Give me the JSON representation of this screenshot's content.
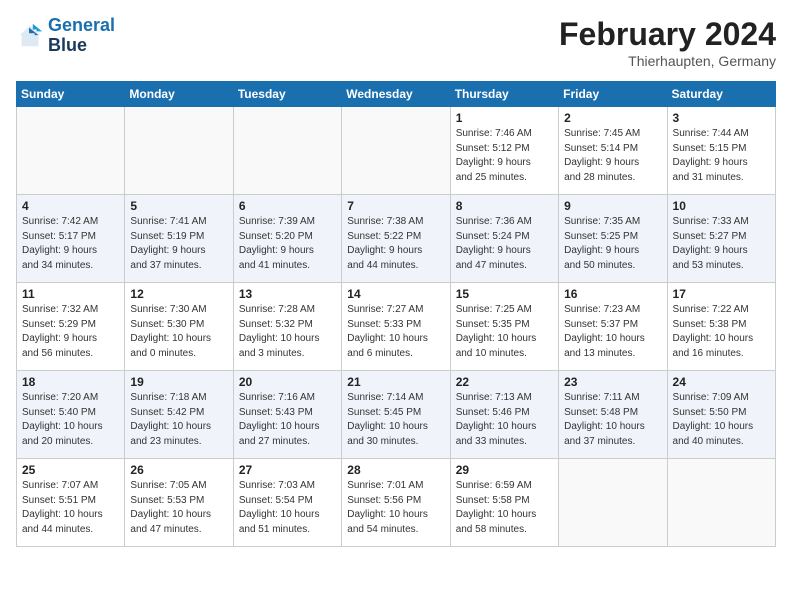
{
  "header": {
    "logo_line1": "General",
    "logo_line2": "Blue",
    "month_title": "February 2024",
    "location": "Thierhaupten, Germany"
  },
  "columns": [
    "Sunday",
    "Monday",
    "Tuesday",
    "Wednesday",
    "Thursday",
    "Friday",
    "Saturday"
  ],
  "weeks": [
    [
      {
        "day": "",
        "info": ""
      },
      {
        "day": "",
        "info": ""
      },
      {
        "day": "",
        "info": ""
      },
      {
        "day": "",
        "info": ""
      },
      {
        "day": "1",
        "info": "Sunrise: 7:46 AM\nSunset: 5:12 PM\nDaylight: 9 hours\nand 25 minutes."
      },
      {
        "day": "2",
        "info": "Sunrise: 7:45 AM\nSunset: 5:14 PM\nDaylight: 9 hours\nand 28 minutes."
      },
      {
        "day": "3",
        "info": "Sunrise: 7:44 AM\nSunset: 5:15 PM\nDaylight: 9 hours\nand 31 minutes."
      }
    ],
    [
      {
        "day": "4",
        "info": "Sunrise: 7:42 AM\nSunset: 5:17 PM\nDaylight: 9 hours\nand 34 minutes."
      },
      {
        "day": "5",
        "info": "Sunrise: 7:41 AM\nSunset: 5:19 PM\nDaylight: 9 hours\nand 37 minutes."
      },
      {
        "day": "6",
        "info": "Sunrise: 7:39 AM\nSunset: 5:20 PM\nDaylight: 9 hours\nand 41 minutes."
      },
      {
        "day": "7",
        "info": "Sunrise: 7:38 AM\nSunset: 5:22 PM\nDaylight: 9 hours\nand 44 minutes."
      },
      {
        "day": "8",
        "info": "Sunrise: 7:36 AM\nSunset: 5:24 PM\nDaylight: 9 hours\nand 47 minutes."
      },
      {
        "day": "9",
        "info": "Sunrise: 7:35 AM\nSunset: 5:25 PM\nDaylight: 9 hours\nand 50 minutes."
      },
      {
        "day": "10",
        "info": "Sunrise: 7:33 AM\nSunset: 5:27 PM\nDaylight: 9 hours\nand 53 minutes."
      }
    ],
    [
      {
        "day": "11",
        "info": "Sunrise: 7:32 AM\nSunset: 5:29 PM\nDaylight: 9 hours\nand 56 minutes."
      },
      {
        "day": "12",
        "info": "Sunrise: 7:30 AM\nSunset: 5:30 PM\nDaylight: 10 hours\nand 0 minutes."
      },
      {
        "day": "13",
        "info": "Sunrise: 7:28 AM\nSunset: 5:32 PM\nDaylight: 10 hours\nand 3 minutes."
      },
      {
        "day": "14",
        "info": "Sunrise: 7:27 AM\nSunset: 5:33 PM\nDaylight: 10 hours\nand 6 minutes."
      },
      {
        "day": "15",
        "info": "Sunrise: 7:25 AM\nSunset: 5:35 PM\nDaylight: 10 hours\nand 10 minutes."
      },
      {
        "day": "16",
        "info": "Sunrise: 7:23 AM\nSunset: 5:37 PM\nDaylight: 10 hours\nand 13 minutes."
      },
      {
        "day": "17",
        "info": "Sunrise: 7:22 AM\nSunset: 5:38 PM\nDaylight: 10 hours\nand 16 minutes."
      }
    ],
    [
      {
        "day": "18",
        "info": "Sunrise: 7:20 AM\nSunset: 5:40 PM\nDaylight: 10 hours\nand 20 minutes."
      },
      {
        "day": "19",
        "info": "Sunrise: 7:18 AM\nSunset: 5:42 PM\nDaylight: 10 hours\nand 23 minutes."
      },
      {
        "day": "20",
        "info": "Sunrise: 7:16 AM\nSunset: 5:43 PM\nDaylight: 10 hours\nand 27 minutes."
      },
      {
        "day": "21",
        "info": "Sunrise: 7:14 AM\nSunset: 5:45 PM\nDaylight: 10 hours\nand 30 minutes."
      },
      {
        "day": "22",
        "info": "Sunrise: 7:13 AM\nSunset: 5:46 PM\nDaylight: 10 hours\nand 33 minutes."
      },
      {
        "day": "23",
        "info": "Sunrise: 7:11 AM\nSunset: 5:48 PM\nDaylight: 10 hours\nand 37 minutes."
      },
      {
        "day": "24",
        "info": "Sunrise: 7:09 AM\nSunset: 5:50 PM\nDaylight: 10 hours\nand 40 minutes."
      }
    ],
    [
      {
        "day": "25",
        "info": "Sunrise: 7:07 AM\nSunset: 5:51 PM\nDaylight: 10 hours\nand 44 minutes."
      },
      {
        "day": "26",
        "info": "Sunrise: 7:05 AM\nSunset: 5:53 PM\nDaylight: 10 hours\nand 47 minutes."
      },
      {
        "day": "27",
        "info": "Sunrise: 7:03 AM\nSunset: 5:54 PM\nDaylight: 10 hours\nand 51 minutes."
      },
      {
        "day": "28",
        "info": "Sunrise: 7:01 AM\nSunset: 5:56 PM\nDaylight: 10 hours\nand 54 minutes."
      },
      {
        "day": "29",
        "info": "Sunrise: 6:59 AM\nSunset: 5:58 PM\nDaylight: 10 hours\nand 58 minutes."
      },
      {
        "day": "",
        "info": ""
      },
      {
        "day": "",
        "info": ""
      }
    ]
  ]
}
